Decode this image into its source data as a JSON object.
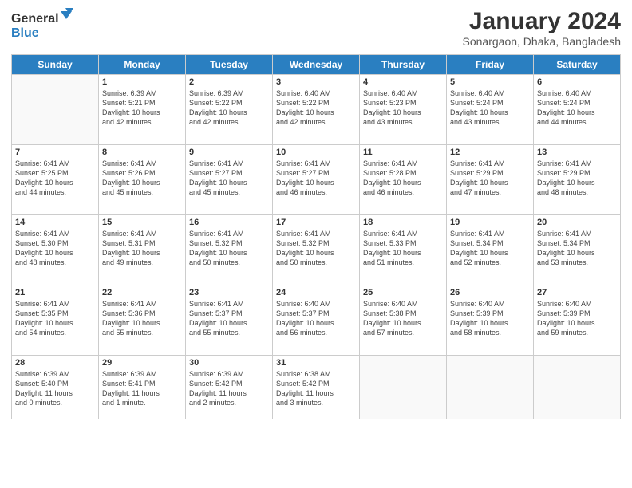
{
  "header": {
    "logo_line1": "General",
    "logo_line2": "Blue",
    "month_year": "January 2024",
    "location": "Sonargaon, Dhaka, Bangladesh"
  },
  "days": [
    "Sunday",
    "Monday",
    "Tuesday",
    "Wednesday",
    "Thursday",
    "Friday",
    "Saturday"
  ],
  "weeks": [
    [
      {
        "date": "",
        "info": ""
      },
      {
        "date": "1",
        "info": "Sunrise: 6:39 AM\nSunset: 5:21 PM\nDaylight: 10 hours\nand 42 minutes."
      },
      {
        "date": "2",
        "info": "Sunrise: 6:39 AM\nSunset: 5:22 PM\nDaylight: 10 hours\nand 42 minutes."
      },
      {
        "date": "3",
        "info": "Sunrise: 6:40 AM\nSunset: 5:22 PM\nDaylight: 10 hours\nand 42 minutes."
      },
      {
        "date": "4",
        "info": "Sunrise: 6:40 AM\nSunset: 5:23 PM\nDaylight: 10 hours\nand 43 minutes."
      },
      {
        "date": "5",
        "info": "Sunrise: 6:40 AM\nSunset: 5:24 PM\nDaylight: 10 hours\nand 43 minutes."
      },
      {
        "date": "6",
        "info": "Sunrise: 6:40 AM\nSunset: 5:24 PM\nDaylight: 10 hours\nand 44 minutes."
      }
    ],
    [
      {
        "date": "7",
        "info": "Sunrise: 6:41 AM\nSunset: 5:25 PM\nDaylight: 10 hours\nand 44 minutes."
      },
      {
        "date": "8",
        "info": "Sunrise: 6:41 AM\nSunset: 5:26 PM\nDaylight: 10 hours\nand 45 minutes."
      },
      {
        "date": "9",
        "info": "Sunrise: 6:41 AM\nSunset: 5:27 PM\nDaylight: 10 hours\nand 45 minutes."
      },
      {
        "date": "10",
        "info": "Sunrise: 6:41 AM\nSunset: 5:27 PM\nDaylight: 10 hours\nand 46 minutes."
      },
      {
        "date": "11",
        "info": "Sunrise: 6:41 AM\nSunset: 5:28 PM\nDaylight: 10 hours\nand 46 minutes."
      },
      {
        "date": "12",
        "info": "Sunrise: 6:41 AM\nSunset: 5:29 PM\nDaylight: 10 hours\nand 47 minutes."
      },
      {
        "date": "13",
        "info": "Sunrise: 6:41 AM\nSunset: 5:29 PM\nDaylight: 10 hours\nand 48 minutes."
      }
    ],
    [
      {
        "date": "14",
        "info": "Sunrise: 6:41 AM\nSunset: 5:30 PM\nDaylight: 10 hours\nand 48 minutes."
      },
      {
        "date": "15",
        "info": "Sunrise: 6:41 AM\nSunset: 5:31 PM\nDaylight: 10 hours\nand 49 minutes."
      },
      {
        "date": "16",
        "info": "Sunrise: 6:41 AM\nSunset: 5:32 PM\nDaylight: 10 hours\nand 50 minutes."
      },
      {
        "date": "17",
        "info": "Sunrise: 6:41 AM\nSunset: 5:32 PM\nDaylight: 10 hours\nand 50 minutes."
      },
      {
        "date": "18",
        "info": "Sunrise: 6:41 AM\nSunset: 5:33 PM\nDaylight: 10 hours\nand 51 minutes."
      },
      {
        "date": "19",
        "info": "Sunrise: 6:41 AM\nSunset: 5:34 PM\nDaylight: 10 hours\nand 52 minutes."
      },
      {
        "date": "20",
        "info": "Sunrise: 6:41 AM\nSunset: 5:34 PM\nDaylight: 10 hours\nand 53 minutes."
      }
    ],
    [
      {
        "date": "21",
        "info": "Sunrise: 6:41 AM\nSunset: 5:35 PM\nDaylight: 10 hours\nand 54 minutes."
      },
      {
        "date": "22",
        "info": "Sunrise: 6:41 AM\nSunset: 5:36 PM\nDaylight: 10 hours\nand 55 minutes."
      },
      {
        "date": "23",
        "info": "Sunrise: 6:41 AM\nSunset: 5:37 PM\nDaylight: 10 hours\nand 55 minutes."
      },
      {
        "date": "24",
        "info": "Sunrise: 6:40 AM\nSunset: 5:37 PM\nDaylight: 10 hours\nand 56 minutes."
      },
      {
        "date": "25",
        "info": "Sunrise: 6:40 AM\nSunset: 5:38 PM\nDaylight: 10 hours\nand 57 minutes."
      },
      {
        "date": "26",
        "info": "Sunrise: 6:40 AM\nSunset: 5:39 PM\nDaylight: 10 hours\nand 58 minutes."
      },
      {
        "date": "27",
        "info": "Sunrise: 6:40 AM\nSunset: 5:39 PM\nDaylight: 10 hours\nand 59 minutes."
      }
    ],
    [
      {
        "date": "28",
        "info": "Sunrise: 6:39 AM\nSunset: 5:40 PM\nDaylight: 11 hours\nand 0 minutes."
      },
      {
        "date": "29",
        "info": "Sunrise: 6:39 AM\nSunset: 5:41 PM\nDaylight: 11 hours\nand 1 minute."
      },
      {
        "date": "30",
        "info": "Sunrise: 6:39 AM\nSunset: 5:42 PM\nDaylight: 11 hours\nand 2 minutes."
      },
      {
        "date": "31",
        "info": "Sunrise: 6:38 AM\nSunset: 5:42 PM\nDaylight: 11 hours\nand 3 minutes."
      },
      {
        "date": "",
        "info": ""
      },
      {
        "date": "",
        "info": ""
      },
      {
        "date": "",
        "info": ""
      }
    ]
  ]
}
